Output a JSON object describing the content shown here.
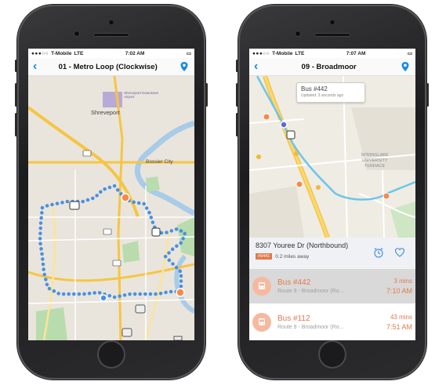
{
  "left": {
    "status": {
      "carrier": "T-Mobile",
      "network": "LTE",
      "time": "7:02 AM"
    },
    "nav": {
      "title": "01 - Metro Loop (Clockwise)"
    },
    "map": {
      "city_label": "Shreveport",
      "city2_label": "Bossier City",
      "airport_label": "Shreveport Downtown Airport"
    }
  },
  "right": {
    "status": {
      "carrier": "T-Mobile",
      "network": "LTE",
      "time": "7:07 AM"
    },
    "nav": {
      "title": "09 - Broadmoor"
    },
    "callout": {
      "title": "Bus #442",
      "subtitle": "Updated: 3 seconds ago"
    },
    "map": {
      "area_label": "SPRINGLAKE UNIVERSITY TERRACE"
    },
    "stop": {
      "name": "8307 Youree Dr (Northbound)",
      "id_badge": "#9441",
      "distance": "0.2 miles away"
    },
    "buses": [
      {
        "name": "Bus #442",
        "route": "Route 9 - Broadmoor (Ro...",
        "mins": "3 mins",
        "time": "7:10 AM"
      },
      {
        "name": "Bus #112",
        "route": "Route 9 - Broadmoor (Ro...",
        "mins": "43 mins",
        "time": "7:51 AM"
      }
    ]
  },
  "colors": {
    "accent": "#1a8be0",
    "route_dot": "#4a90e2",
    "bus_orange": "#e07a4d",
    "highlight_row": "#d9d9d9"
  }
}
